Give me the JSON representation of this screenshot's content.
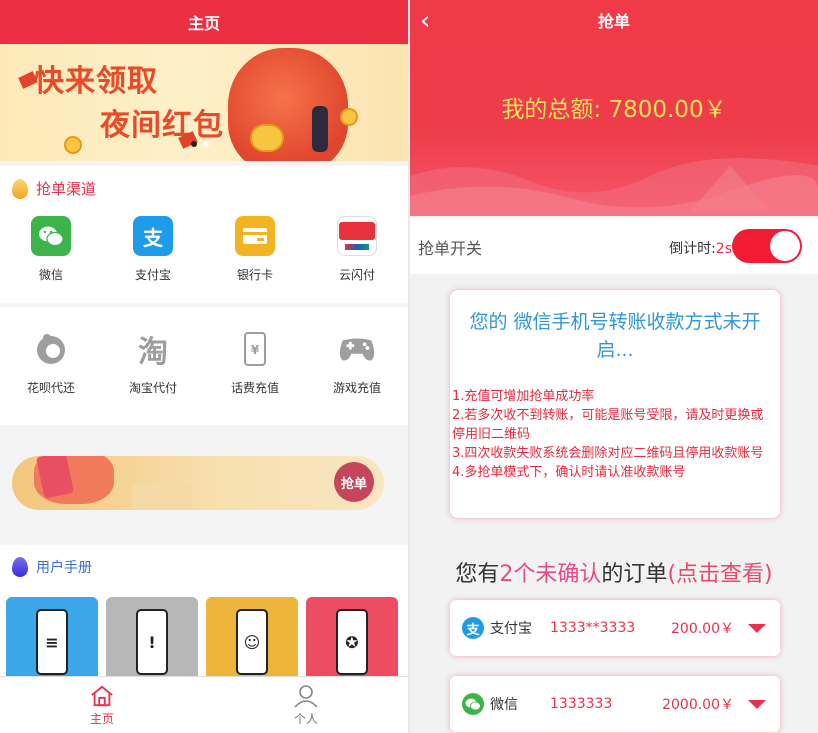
{
  "home": {
    "title": "主页",
    "banner": {
      "line1": "快来领取",
      "line2": "夜间红包"
    },
    "channels": {
      "title": "抢单渠道",
      "items": [
        {
          "label": "微信",
          "icon": "wechat-icon",
          "color": "#3bb54a"
        },
        {
          "label": "支付宝",
          "icon": "alipay-icon",
          "color": "#1e9be9"
        },
        {
          "label": "银行卡",
          "icon": "bank-card-icon",
          "color": "#f4b320"
        },
        {
          "label": "云闪付",
          "icon": "unionpay-quickpass-icon",
          "color": "#e8313c"
        }
      ]
    },
    "services": {
      "items": [
        {
          "label": "花呗代还",
          "icon": "huabei-icon"
        },
        {
          "label": "淘宝代付",
          "icon": "taobao-icon"
        },
        {
          "label": "话费充值",
          "icon": "phone-recharge-icon"
        },
        {
          "label": "游戏充值",
          "icon": "gamepad-icon"
        }
      ]
    },
    "promo": {
      "button": "抢单"
    },
    "manual": {
      "title": "用户手册",
      "cards": [
        {
          "icon": "document-phone-icon",
          "color": "#3ba6e8"
        },
        {
          "icon": "alert-phone-icon",
          "color": "#b7b7b7"
        },
        {
          "icon": "users-phone-icon",
          "color": "#efb53b"
        },
        {
          "icon": "badge-phone-icon",
          "color": "#ec4d63"
        }
      ]
    },
    "tabbar": {
      "home": "主页",
      "profile": "个人"
    }
  },
  "grab": {
    "title": "抢单",
    "total_label": "我的总额: 7800.00￥",
    "switch_label": "抢单开关",
    "countdown_label": "倒计时:",
    "countdown_value": "2s",
    "switch_on": true,
    "notice": {
      "heading": "您的 微信手机号转账收款方式未开启...",
      "rules": [
        "1.充值可增加抢单成功率",
        "2.若多次收不到转账，可能是账号受限，请及时更换或停用旧二维码",
        "3.四次收款失败系统会删除对应二维码且停用收款账号",
        "4.多抢单模式下，确认时请认准收款账号"
      ]
    },
    "orders_title": {
      "pre": "您有",
      "count": "2个",
      "status": "未确认",
      "post": "的订单",
      "link": "(点击查看)"
    },
    "orders": [
      {
        "method": "支付宝",
        "account": "1333**3333",
        "amount": "200.00￥",
        "icon": "alipay-icon",
        "color": "#1e9be9"
      },
      {
        "method": "微信",
        "account": "1333333",
        "amount": "2000.00￥",
        "icon": "wechat-icon",
        "color": "#3bb54a"
      }
    ]
  },
  "colors": {
    "accent": "#ec2e43",
    "total_text": "#f6e35a",
    "notice_head": "#2e96dc",
    "notice_rules": "#e82a3a"
  }
}
